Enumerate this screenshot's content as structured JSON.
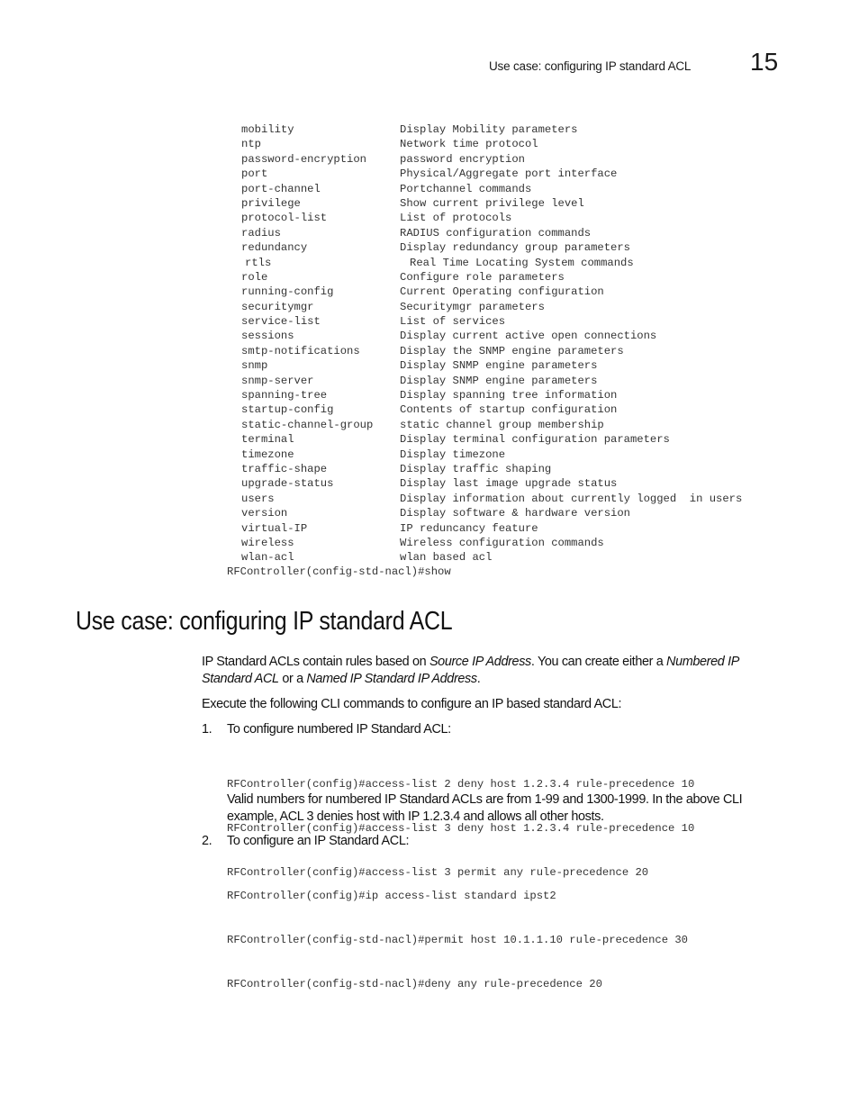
{
  "header": {
    "running_title": "Use case: configuring IP standard ACL",
    "chapter_number": "15"
  },
  "show_commands": [
    {
      "name": "mobility",
      "desc": "Display Mobility parameters"
    },
    {
      "name": "ntp",
      "desc": "Network time protocol"
    },
    {
      "name": "password-encryption",
      "desc": "password encryption"
    },
    {
      "name": "port",
      "desc": "Physical/Aggregate port interface"
    },
    {
      "name": "port-channel",
      "desc": "Portchannel commands"
    },
    {
      "name": "privilege",
      "desc": "Show current privilege level"
    },
    {
      "name": "protocol-list",
      "desc": "List of protocols"
    },
    {
      "name": "radius",
      "desc": "RADIUS configuration commands"
    },
    {
      "name": "redundancy",
      "desc": "Display redundancy group parameters"
    },
    {
      "name": "rtls",
      "desc": "Real Time Locating System commands"
    },
    {
      "name": "role",
      "desc": "Configure role parameters"
    },
    {
      "name": "running-config",
      "desc": "Current Operating configuration"
    },
    {
      "name": "securitymgr",
      "desc": "Securitymgr parameters"
    },
    {
      "name": "service-list",
      "desc": "List of services"
    },
    {
      "name": "sessions",
      "desc": "Display current active open connections"
    },
    {
      "name": "smtp-notifications",
      "desc": "Display the SNMP engine parameters"
    },
    {
      "name": "snmp",
      "desc": "Display SNMP engine parameters"
    },
    {
      "name": "snmp-server",
      "desc": "Display SNMP engine parameters"
    },
    {
      "name": "spanning-tree",
      "desc": "Display spanning tree information"
    },
    {
      "name": "startup-config",
      "desc": "Contents of startup configuration"
    },
    {
      "name": "static-channel-group",
      "desc": "static channel group membership"
    },
    {
      "name": "terminal",
      "desc": "Display terminal configuration parameters"
    },
    {
      "name": "timezone",
      "desc": "Display timezone"
    },
    {
      "name": "traffic-shape",
      "desc": "Display traffic shaping"
    },
    {
      "name": "upgrade-status",
      "desc": "Display last image upgrade status"
    },
    {
      "name": "users",
      "desc": "Display information about currently logged  in users"
    },
    {
      "name": "version",
      "desc": "Display software & hardware version"
    },
    {
      "name": "virtual-IP",
      "desc": "IP reduncancy feature"
    },
    {
      "name": "wireless",
      "desc": "Wireless configuration commands"
    },
    {
      "name": "wlan-acl",
      "desc": "wlan based acl"
    }
  ],
  "show_prompt": "RFController(config-std-nacl)#show",
  "section": {
    "title": "Use case: configuring IP standard ACL",
    "intro": {
      "t1": "IP Standard ACLs contain rules based on ",
      "i1": "Source IP Address",
      "t2": ". You can create either a ",
      "i2": "Numbered IP Standard ACL",
      "t3": " or a ",
      "i3": "Named IP Standard IP Address",
      "t4": "."
    },
    "instruction": "Execute the following CLI commands to configure an IP based standard ACL:",
    "steps": [
      {
        "number": "1.",
        "label": "To configure numbered IP Standard ACL:",
        "code": [
          "RFController(config)#access-list 2 deny host 1.2.3.4 rule-precedence 10",
          "RFController(config)#access-list 3 deny host 1.2.3.4 rule-precedence 10",
          "RFController(config)#access-list 3 permit any rule-precedence 20"
        ],
        "note": "Valid numbers for numbered IP Standard ACLs are from 1-99 and 1300-1999. In the above CLI example, ACL 3 denies host with IP 1.2.3.4 and allows all other hosts."
      },
      {
        "number": "2.",
        "label": "To configure an IP Standard ACL:",
        "code": [
          "RFController(config)#ip access-list standard ipst2",
          "RFController(config-std-nacl)#permit host 10.1.1.10 rule-precedence 30",
          "RFController(config-std-nacl)#deny any rule-precedence 20"
        ]
      }
    ]
  }
}
